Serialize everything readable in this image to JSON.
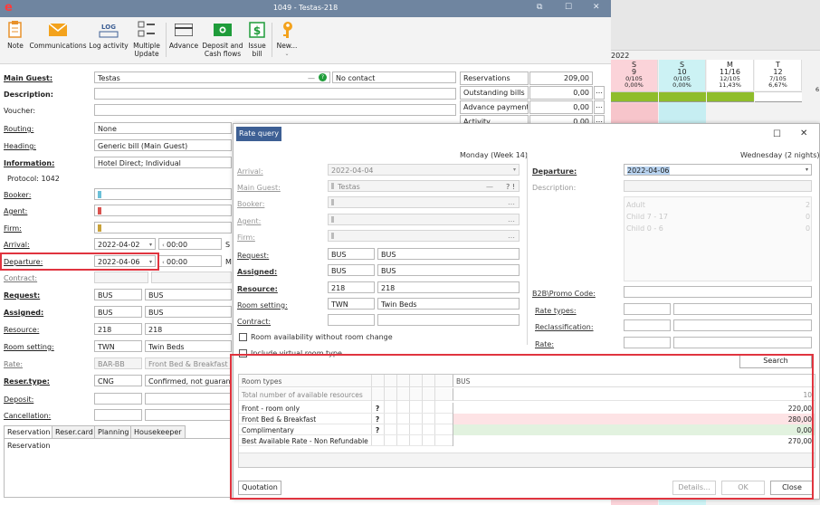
{
  "window": {
    "title": "1049 - Testas-218",
    "logo": "e"
  },
  "ribbon": [
    {
      "label": "Note",
      "icon": "note-icon"
    },
    {
      "label": "Communications",
      "icon": "envelope-icon"
    },
    {
      "label": "Log activity",
      "icon": "log-icon",
      "badge": "LOG"
    },
    {
      "label": "Multiple Update",
      "icon": "checklist-icon"
    },
    {
      "label": "Advance",
      "icon": "card-icon"
    },
    {
      "label": "Deposit and Cash flows",
      "icon": "cash-icon"
    },
    {
      "label": "Issue bill",
      "icon": "dollar-icon"
    },
    {
      "label": "New...",
      "icon": "key-icon"
    }
  ],
  "form": {
    "main_guest_label": "Main Guest:",
    "main_guest_value": "Testas",
    "no_contact": "No contact",
    "description_label": "Description:",
    "voucher_label": "Voucher:",
    "routing_label": "Routing:",
    "routing_value": "None",
    "heading_label": "Heading:",
    "heading_value": "Generic bill (Main Guest)",
    "information_label": "Information:",
    "information_value": "Hotel Direct; Individual",
    "protocol": "Protocol: 1042",
    "booker_label": "Booker:",
    "agent_label": "Agent:",
    "firm_label": "Firm:",
    "arrival_label": "Arrival:",
    "arrival_date": "2022-04-02",
    "arrival_time": "00:00",
    "departure_label": "Departure:",
    "departure_date": "2022-04-06",
    "departure_time": "00:00",
    "contract_label": "Contract:",
    "request_label": "Request:",
    "request_code": "BUS",
    "request_name": "BUS",
    "assigned_label": "Assigned:",
    "assigned_code": "BUS",
    "assigned_name": "BUS",
    "resource_label": "Resource:",
    "resource_code": "218",
    "resource_name": "218",
    "room_setting_label": "Room setting:",
    "room_setting_code": "TWN",
    "room_setting_name": "Twin Beds",
    "rate_label": "Rate:",
    "rate_code": "BAR-BB",
    "rate_name": "Front Bed & Breakfast",
    "reser_type_label": "Reser.type:",
    "reser_type_code": "CNG",
    "reser_type_name": "Confirmed, not guarantee",
    "deposit_label": "Deposit:",
    "cancellation_label": "Cancellation:",
    "cut_s": "S",
    "cut_m": "M"
  },
  "summary": [
    {
      "label": "Reservations",
      "value": "209,00"
    },
    {
      "label": "Outstanding bills",
      "value": "0,00"
    },
    {
      "label": "Advance payments",
      "value": "0,00"
    },
    {
      "label": "Activity",
      "value": "0,00"
    }
  ],
  "tabs": [
    "Reservation",
    "Reser.card",
    "Planning",
    "Housekeeper"
  ],
  "tab_content": "Reservation",
  "calendar": {
    "year": "2022",
    "days": [
      {
        "d": "S",
        "n": "9",
        "cap": "0/105",
        "pct": "0,00%",
        "bg": "#fbd3d9"
      },
      {
        "d": "S",
        "n": "10",
        "cap": "0/105",
        "pct": "0,00%",
        "bg": "#ccf2f4"
      },
      {
        "d": "M",
        "n": "11/16",
        "cap": "12/105",
        "pct": "11,43%",
        "bg": "#ffffff"
      },
      {
        "d": "T",
        "n": "12",
        "cap": "7/105",
        "pct": "6,67%",
        "bg": "#ffffff"
      }
    ],
    "extra": "6"
  },
  "dialog": {
    "title": "Rate query",
    "arrival_week": "Monday (Week 14)",
    "departure_week": "Wednesday (2 nights)",
    "arrival_label": "Arrival:",
    "arrival_value": "2022-04-04",
    "main_guest_label": "Main Guest:",
    "main_guest_value": "Testas",
    "guest_marks": "? !",
    "booker_label": "Booker:",
    "agent_label": "Agent:",
    "firm_label": "Firm:",
    "request_label": "Request:",
    "request_code": "BUS",
    "request_name": "BUS",
    "assigned_label": "Assigned:",
    "assigned_code": "BUS",
    "assigned_name": "BUS",
    "resource_label": "Resource:",
    "resource_code": "218",
    "resource_name": "218",
    "room_setting_label": "Room setting:",
    "room_setting_code": "TWN",
    "room_setting_name": "Twin Beds",
    "contract_label": "Contract:",
    "departure_label": "Departure:",
    "departure_value": "2022-04-06",
    "description_label": "Description:",
    "pax": [
      {
        "label": "Adult",
        "value": "2"
      },
      {
        "label": "Child 7 - 17",
        "value": "0"
      },
      {
        "label": "Child 0 - 6",
        "value": "0"
      }
    ],
    "promo_label": "B2B\\Promo Code:",
    "rate_types_label": "Rate types:",
    "reclass_label": "Reclassification:",
    "rate_label": "Rate:",
    "cb1": "Room availability without room change",
    "cb2": "Include virtual room type",
    "search": "Search",
    "grid_head": "Room types",
    "grid_col": "BUS",
    "total_label": "Total number of available resources",
    "total_value": "10",
    "rows": [
      {
        "name": "Front - room only",
        "mark": "?",
        "value": "220,00",
        "bg": "#ffffff"
      },
      {
        "name": "Front Bed & Breakfast",
        "mark": "?",
        "value": "280,00",
        "bg": "#fde3e5"
      },
      {
        "name": "Complimentary",
        "mark": "?",
        "value": "0,00",
        "bg": "#e2f2df"
      },
      {
        "name": "Best Available Rate - Non Refundable",
        "mark": "",
        "value": "270,00",
        "bg": "#ffffff"
      }
    ],
    "quotation": "Quotation",
    "details": "Details...",
    "ok": "OK",
    "close": "Close"
  },
  "colors": {
    "titlebar": "#6f85a0",
    "highlight": "#e0343f",
    "accent": "#3d5f94"
  }
}
